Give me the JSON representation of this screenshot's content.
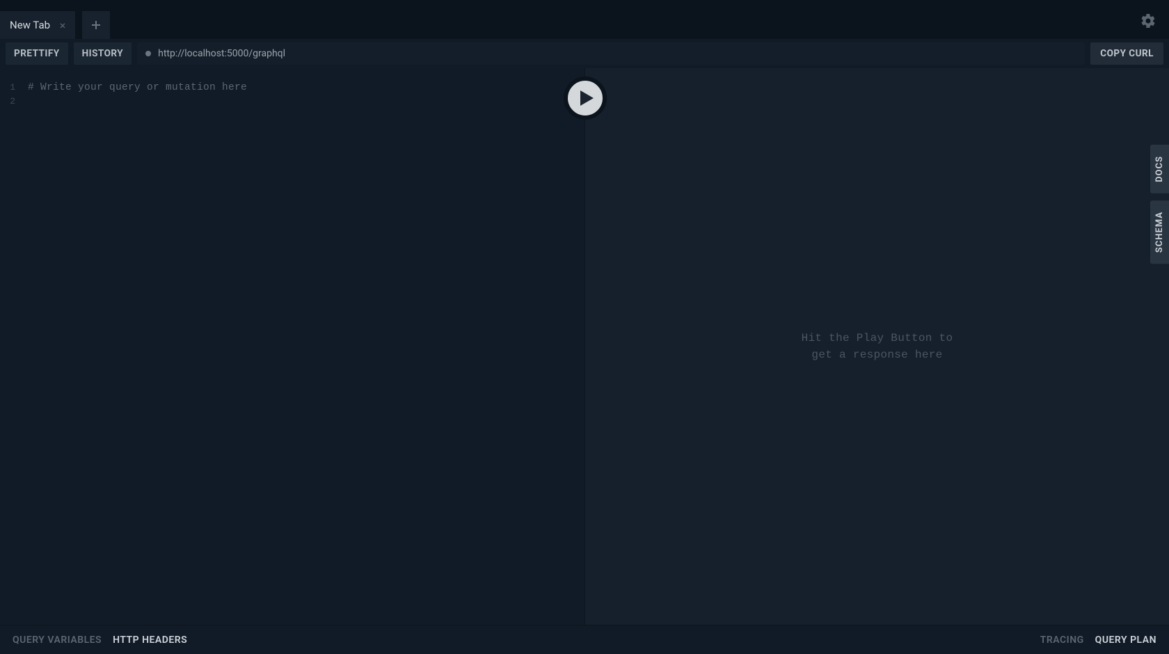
{
  "tabs": {
    "active_label": "New Tab"
  },
  "toolbar": {
    "prettify": "PRETTIFY",
    "history": "HISTORY",
    "copy_curl": "COPY CURL"
  },
  "url": "http://localhost:5000/graphql",
  "editor": {
    "line_numbers": [
      "1",
      "2"
    ],
    "comment": "# Write your query or mutation here"
  },
  "response": {
    "placeholder": "Hit the Play Button to\nget a response here"
  },
  "side": {
    "docs": "DOCS",
    "schema": "SCHEMA"
  },
  "footer": {
    "query_variables": "QUERY VARIABLES",
    "http_headers": "HTTP HEADERS",
    "tracing": "TRACING",
    "query_plan": "QUERY PLAN"
  }
}
